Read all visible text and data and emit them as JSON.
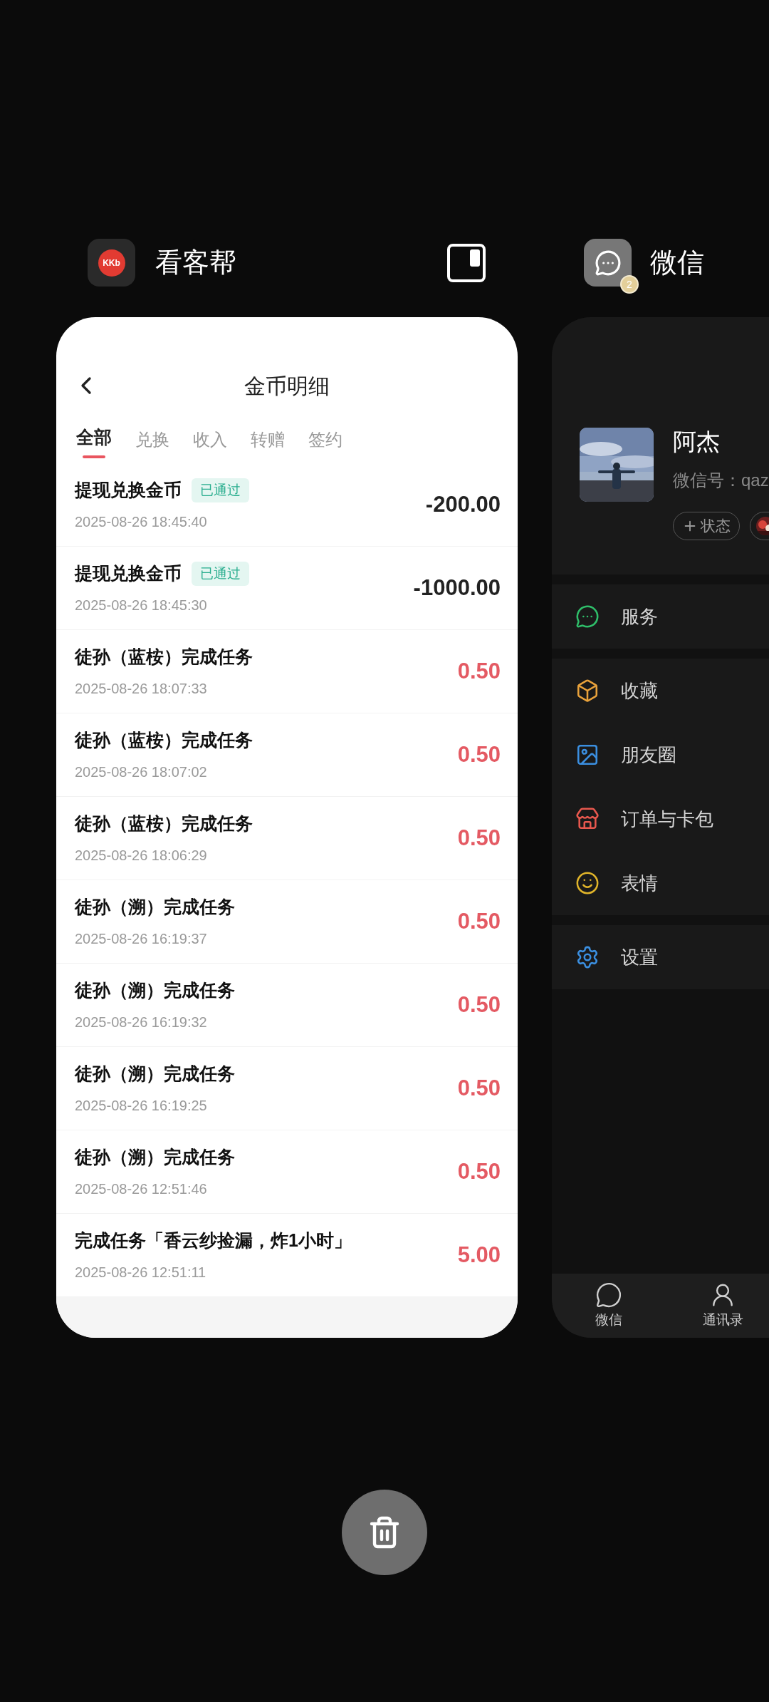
{
  "left_app": {
    "label": "看客帮",
    "logo_text": "KKb"
  },
  "right_app": {
    "label": "微信",
    "badge": "2"
  },
  "coin_detail": {
    "title": "金币明细",
    "tabs": [
      {
        "label": "全部",
        "selected": true
      },
      {
        "label": "兑换",
        "selected": false
      },
      {
        "label": "收入",
        "selected": false
      },
      {
        "label": "转赠",
        "selected": false
      },
      {
        "label": "签约",
        "selected": false
      }
    ],
    "records": [
      {
        "title": "提现兑换金币",
        "status": "已通过",
        "time": "2025-08-26 18:45:40",
        "amount": "-200.00",
        "kind": "debit"
      },
      {
        "title": "提现兑换金币",
        "status": "已通过",
        "time": "2025-08-26 18:45:30",
        "amount": "-1000.00",
        "kind": "debit"
      },
      {
        "title": "徒孙（蓝桉）完成任务",
        "time": "2025-08-26 18:07:33",
        "amount": "0.50",
        "kind": "credit"
      },
      {
        "title": "徒孙（蓝桉）完成任务",
        "time": "2025-08-26 18:07:02",
        "amount": "0.50",
        "kind": "credit"
      },
      {
        "title": "徒孙（蓝桉）完成任务",
        "time": "2025-08-26 18:06:29",
        "amount": "0.50",
        "kind": "credit"
      },
      {
        "title": "徒孙（溯）完成任务",
        "time": "2025-08-26 16:19:37",
        "amount": "0.50",
        "kind": "credit"
      },
      {
        "title": "徒孙（溯）完成任务",
        "time": "2025-08-26 16:19:32",
        "amount": "0.50",
        "kind": "credit"
      },
      {
        "title": "徒孙（溯）完成任务",
        "time": "2025-08-26 16:19:25",
        "amount": "0.50",
        "kind": "credit"
      },
      {
        "title": "徒孙（溯）完成任务",
        "time": "2025-08-26 12:51:46",
        "amount": "0.50",
        "kind": "credit"
      },
      {
        "title": "完成任务「香云纱捡漏，炸1小时」",
        "time": "2025-08-26 12:51:11",
        "amount": "5.00",
        "kind": "credit"
      }
    ]
  },
  "wechat": {
    "profile": {
      "name": "阿杰",
      "wechat_id": "微信号：qaz",
      "status_button": "状态"
    },
    "menu_sections": [
      [
        {
          "label": "服务",
          "kind": "service"
        }
      ],
      [
        {
          "label": "收藏",
          "kind": "favorites"
        },
        {
          "label": "朋友圈",
          "kind": "moments"
        },
        {
          "label": "订单与卡包",
          "kind": "orders"
        },
        {
          "label": "表情",
          "kind": "stickers"
        }
      ],
      [
        {
          "label": "设置",
          "kind": "settings"
        }
      ]
    ],
    "tab_bar": [
      {
        "label": "微信",
        "kind": "chats"
      },
      {
        "label": "通讯录",
        "kind": "contacts"
      }
    ]
  }
}
